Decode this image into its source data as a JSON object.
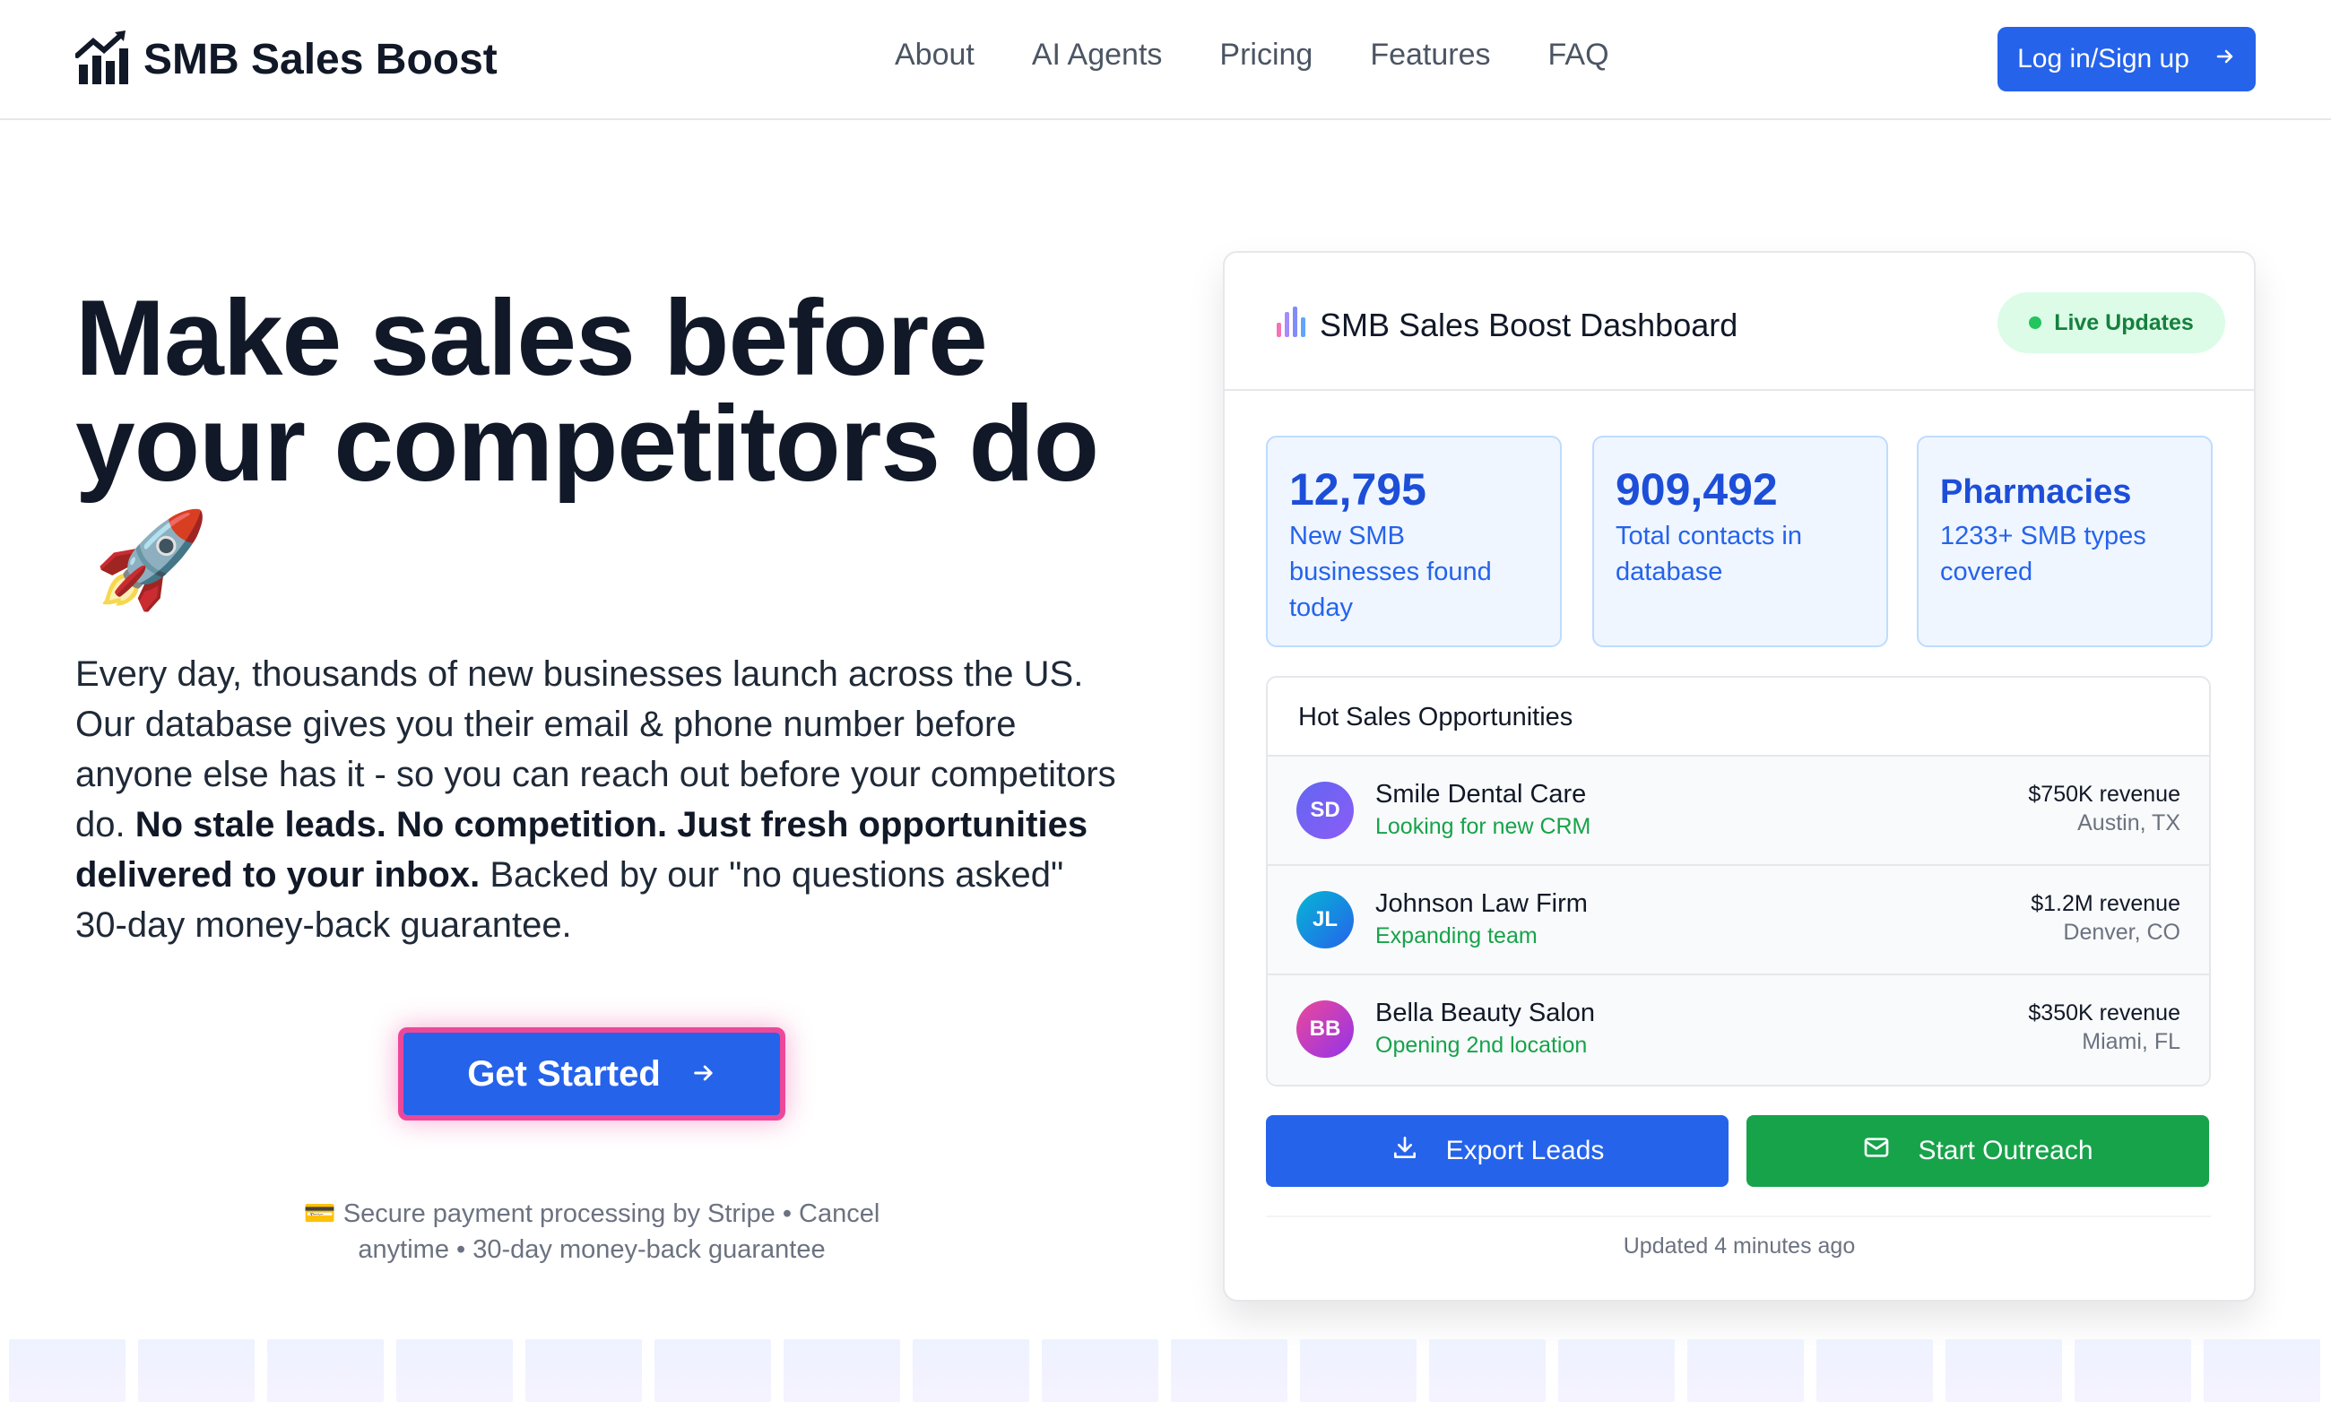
{
  "header": {
    "brand": "SMB Sales Boost",
    "brand_icon": "chart-growth-icon",
    "nav": [
      "About",
      "AI Agents",
      "Pricing",
      "Features",
      "FAQ"
    ],
    "login_label": "Log in/Sign up"
  },
  "hero": {
    "title": "Make sales before your competitors do",
    "emoji": "🚀",
    "desc_part1": "Every day, thousands of new businesses launch across the US. Our database gives you their email & phone number before anyone else has it - so you can reach out before your competitors do. ",
    "desc_bold": "No stale leads. No competition. Just fresh opportunities delivered to your inbox.",
    "desc_part2": " Backed by our \"no questions asked\" 30-day money-back guarantee.",
    "cta_label": "Get Started",
    "secure_text": "💳 Secure payment processing by Stripe • Cancel anytime • 30-day money-back guarantee"
  },
  "dashboard": {
    "title": "SMB Sales Boost Dashboard",
    "live_label": "Live Updates",
    "stats": [
      {
        "value": "12,795",
        "label": "New SMB businesses found today"
      },
      {
        "value": "909,492",
        "label": "Total contacts in database"
      },
      {
        "value": "Pharmacies",
        "label": "1233+ SMB types covered"
      }
    ],
    "opps_title": "Hot Sales Opportunities",
    "opportunities": [
      {
        "initials": "SD",
        "name": "Smile Dental Care",
        "status": "Looking for new CRM",
        "revenue": "$750K revenue",
        "location": "Austin, TX"
      },
      {
        "initials": "JL",
        "name": "Johnson Law Firm",
        "status": "Expanding team",
        "revenue": "$1.2M revenue",
        "location": "Denver, CO"
      },
      {
        "initials": "BB",
        "name": "Bella Beauty Salon",
        "status": "Opening 2nd location",
        "revenue": "$350K revenue",
        "location": "Miami, FL"
      }
    ],
    "export_label": "Export Leads",
    "outreach_label": "Start Outreach",
    "updated": "Updated 4 minutes ago"
  },
  "colors": {
    "primary": "#2563eb",
    "success": "#16a34a",
    "cta_glow": "#ec4899"
  }
}
